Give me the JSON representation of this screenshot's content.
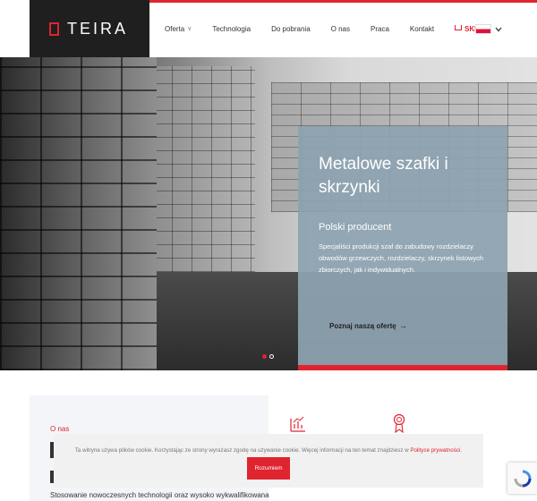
{
  "brand": {
    "name": "TEIRA",
    "accent": "#e0242f"
  },
  "nav": {
    "items": [
      {
        "label": "Oferta",
        "has_dropdown": true
      },
      {
        "label": "Technologia"
      },
      {
        "label": "Do pobrania"
      },
      {
        "label": "O nas"
      },
      {
        "label": "Praca"
      },
      {
        "label": "Kontakt"
      }
    ],
    "shop_label": "SKLEP",
    "language": "PL"
  },
  "hero": {
    "title": "Metalowe szafki i skrzynki",
    "subtitle": "Polski producent",
    "description": "Specjaliści produkcji szaf do zabudowy rozdzielaczy obwodów grzewczych, rozdzielaczy, skrzynek listowych zbiorczych, jak i indywidualnych.",
    "cta": "Poznaj naszą ofertę",
    "cta_arrow": "→",
    "slides_total": 2,
    "active_slide": 1
  },
  "about": {
    "label": "O nas",
    "text": "Stosowanie nowoczesnych technologii oraz wysoko wykwalifikowana"
  },
  "cookie": {
    "text": "Ta witryna używa plików cookie. Korzystając ze strony wyrażasz zgodę na używanie cookie. Więcej informacji na ten temat znajdziesz w",
    "link_label": "Polityce prywatności",
    "text_end": ".",
    "button_label": "Rozumiem"
  },
  "icons": {
    "nav_chevron": "chevron-down-icon",
    "cart": "basket-icon",
    "recaptcha": "recaptcha-icon"
  }
}
